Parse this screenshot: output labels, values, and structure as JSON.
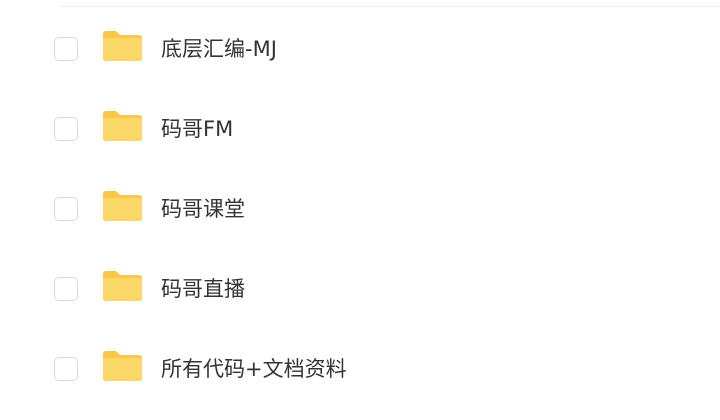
{
  "colors": {
    "folder_back": "#F6C74D",
    "folder_front": "#FBD867",
    "text": "#333333",
    "checkbox_border": "#D9D9D9",
    "divider": "#EEEEEE"
  },
  "files": [
    {
      "name": "底层汇编-MJ",
      "type": "folder",
      "icon": "folder-icon",
      "checked": false
    },
    {
      "name": "码哥FM",
      "type": "folder",
      "icon": "folder-icon",
      "checked": false
    },
    {
      "name": "码哥课堂",
      "type": "folder",
      "icon": "folder-icon",
      "checked": false
    },
    {
      "name": "码哥直播",
      "type": "folder",
      "icon": "folder-icon",
      "checked": false
    },
    {
      "name": "所有代码+文档资料",
      "type": "folder",
      "icon": "folder-icon",
      "checked": false
    }
  ]
}
